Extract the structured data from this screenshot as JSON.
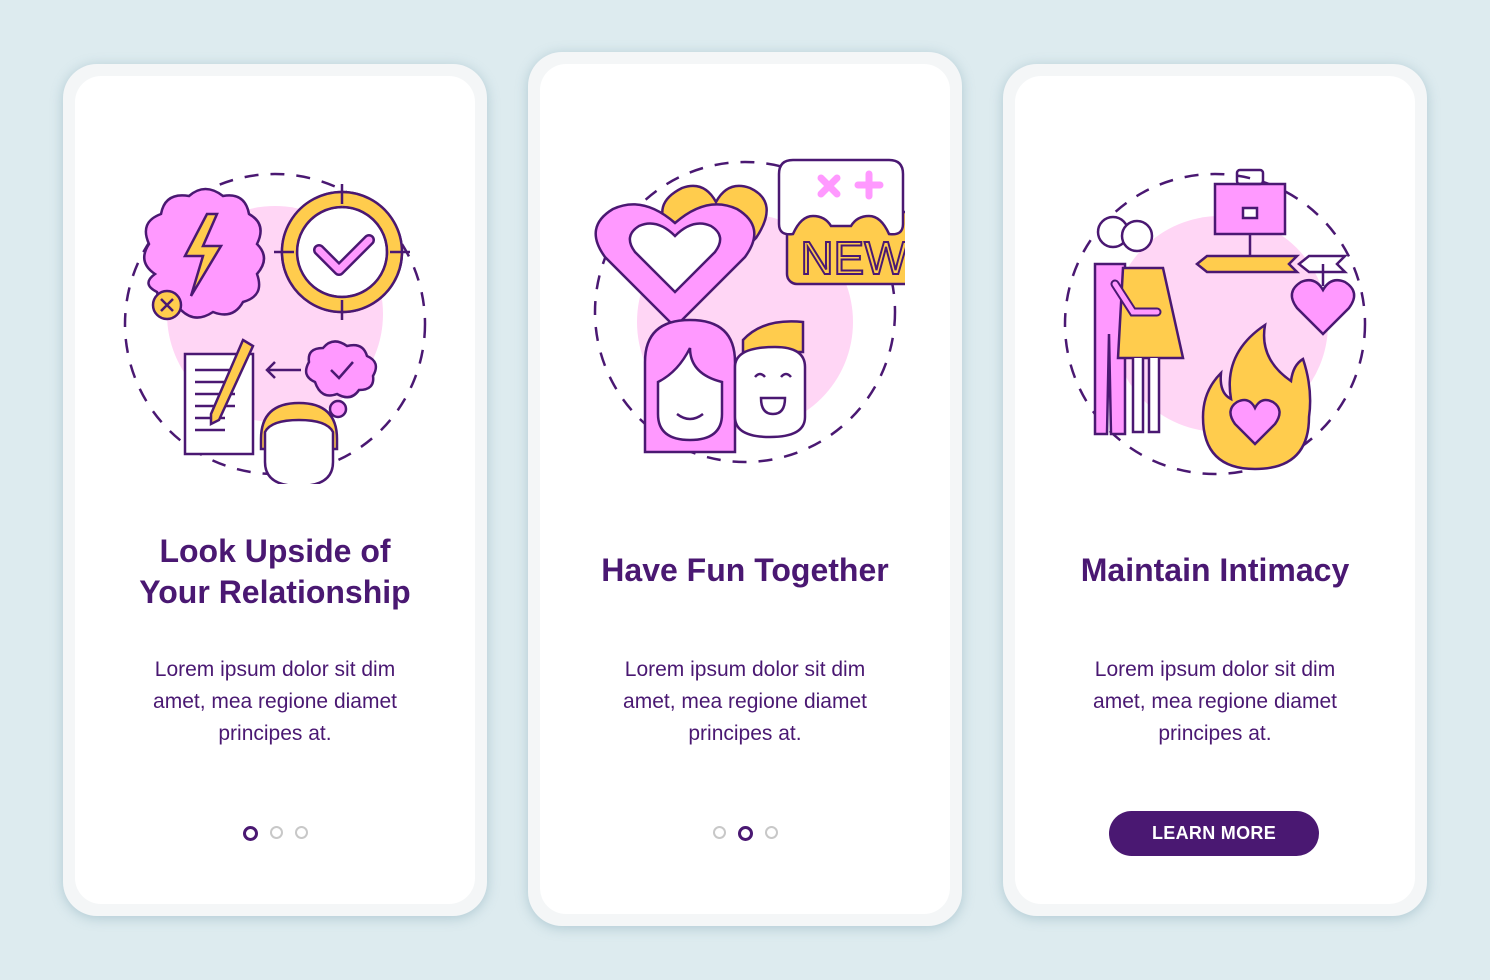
{
  "colors": {
    "background": "#ddebef",
    "accent": "#4a1872",
    "pink": "#ff99ff",
    "light_pink": "#ffd6f5",
    "yellow": "#ffcc4d",
    "dot_inactive": "#c8c8c8"
  },
  "screens": [
    {
      "title": "Look Upside of Your Relationship",
      "title_lines": [
        "Look Upside of",
        "Your Relationship"
      ],
      "body_lines": [
        "Lorem ipsum dolor sit dim",
        "amet, mea regione diamet",
        "principes at."
      ],
      "illustration": "relationship-upside-illustration",
      "page_indicator": {
        "total": 3,
        "active": 1
      }
    },
    {
      "title": "Have Fun Together",
      "body_lines": [
        "Lorem ipsum dolor sit dim",
        "amet, mea regione diamet",
        "principes at."
      ],
      "illustration": "fun-together-illustration",
      "illustration_badge": "NEW",
      "page_indicator": {
        "total": 3,
        "active": 2
      }
    },
    {
      "title": "Maintain Intimacy",
      "body_lines": [
        "Lorem ipsum dolor sit dim",
        "amet, mea regione diamet",
        "principes at."
      ],
      "illustration": "intimacy-illustration",
      "button_label": "LEARN MORE"
    }
  ]
}
